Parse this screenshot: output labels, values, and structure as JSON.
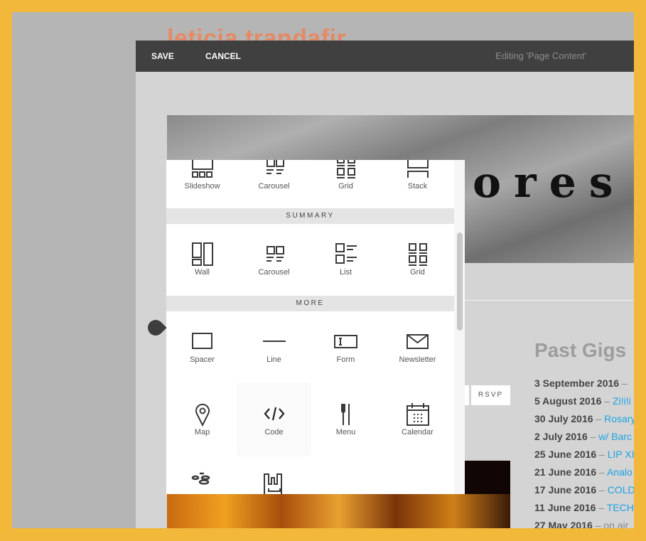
{
  "site": {
    "logo": "leticia trandafir",
    "banner_text": "ores"
  },
  "toolbar": {
    "save": "SAVE",
    "cancel": "CANCEL",
    "status": "Editing 'Page Content'"
  },
  "picker": {
    "gallery": [
      {
        "label": "Slideshow",
        "icon": "slideshow-icon"
      },
      {
        "label": "Carousel",
        "icon": "carousel-icon"
      },
      {
        "label": "Grid",
        "icon": "grid-icon"
      },
      {
        "label": "Stack",
        "icon": "stack-icon"
      }
    ],
    "summary_title": "SUMMARY",
    "summary": [
      {
        "label": "Wall",
        "icon": "wall-icon"
      },
      {
        "label": "Carousel",
        "icon": "carousel-icon"
      },
      {
        "label": "List",
        "icon": "list-icon"
      },
      {
        "label": "Grid",
        "icon": "grid-icon"
      }
    ],
    "more_title": "MORE",
    "more": [
      {
        "label": "Spacer",
        "icon": "spacer-icon"
      },
      {
        "label": "Line",
        "icon": "line-icon"
      },
      {
        "label": "Form",
        "icon": "form-icon"
      },
      {
        "label": "Newsletter",
        "icon": "envelope-icon"
      },
      {
        "label": "Map",
        "icon": "map-pin-icon"
      },
      {
        "label": "Code",
        "icon": "code-icon",
        "highlighted": true
      },
      {
        "label": "Menu",
        "icon": "fork-knife-icon"
      },
      {
        "label": "Calendar",
        "icon": "calendar-icon"
      }
    ]
  },
  "content": {
    "rsvp": "RSVP",
    "past_gigs_title": "Past Gigs",
    "gigs": [
      {
        "date": "3 September 2016",
        "sep": " – ",
        "link": ""
      },
      {
        "date": "5 August 2016",
        "sep": " – ",
        "link": "Zi!i!i"
      },
      {
        "date": "30 July 2016",
        "sep": " – ",
        "link": "Rosary"
      },
      {
        "date": "2 July 2016",
        "sep": " – ",
        "link": "w/ Barc"
      },
      {
        "date": "25 June 2016",
        "sep": " – ",
        "link": "LIP XI"
      },
      {
        "date": "21 June 2016",
        "sep": " –  ",
        "link": "Analo"
      },
      {
        "date": "17 June 2016",
        "sep": " – ",
        "link": "COLD"
      },
      {
        "date": "11 June 2016",
        "sep": " – ",
        "link": "TECH"
      },
      {
        "date": "27 May 2016",
        "sep": " – on air",
        "link": ""
      }
    ]
  },
  "colors": {
    "border": "#f2b83a",
    "toolbar": "#404040",
    "link": "#1ea3e3",
    "logo": "#e58a64"
  }
}
